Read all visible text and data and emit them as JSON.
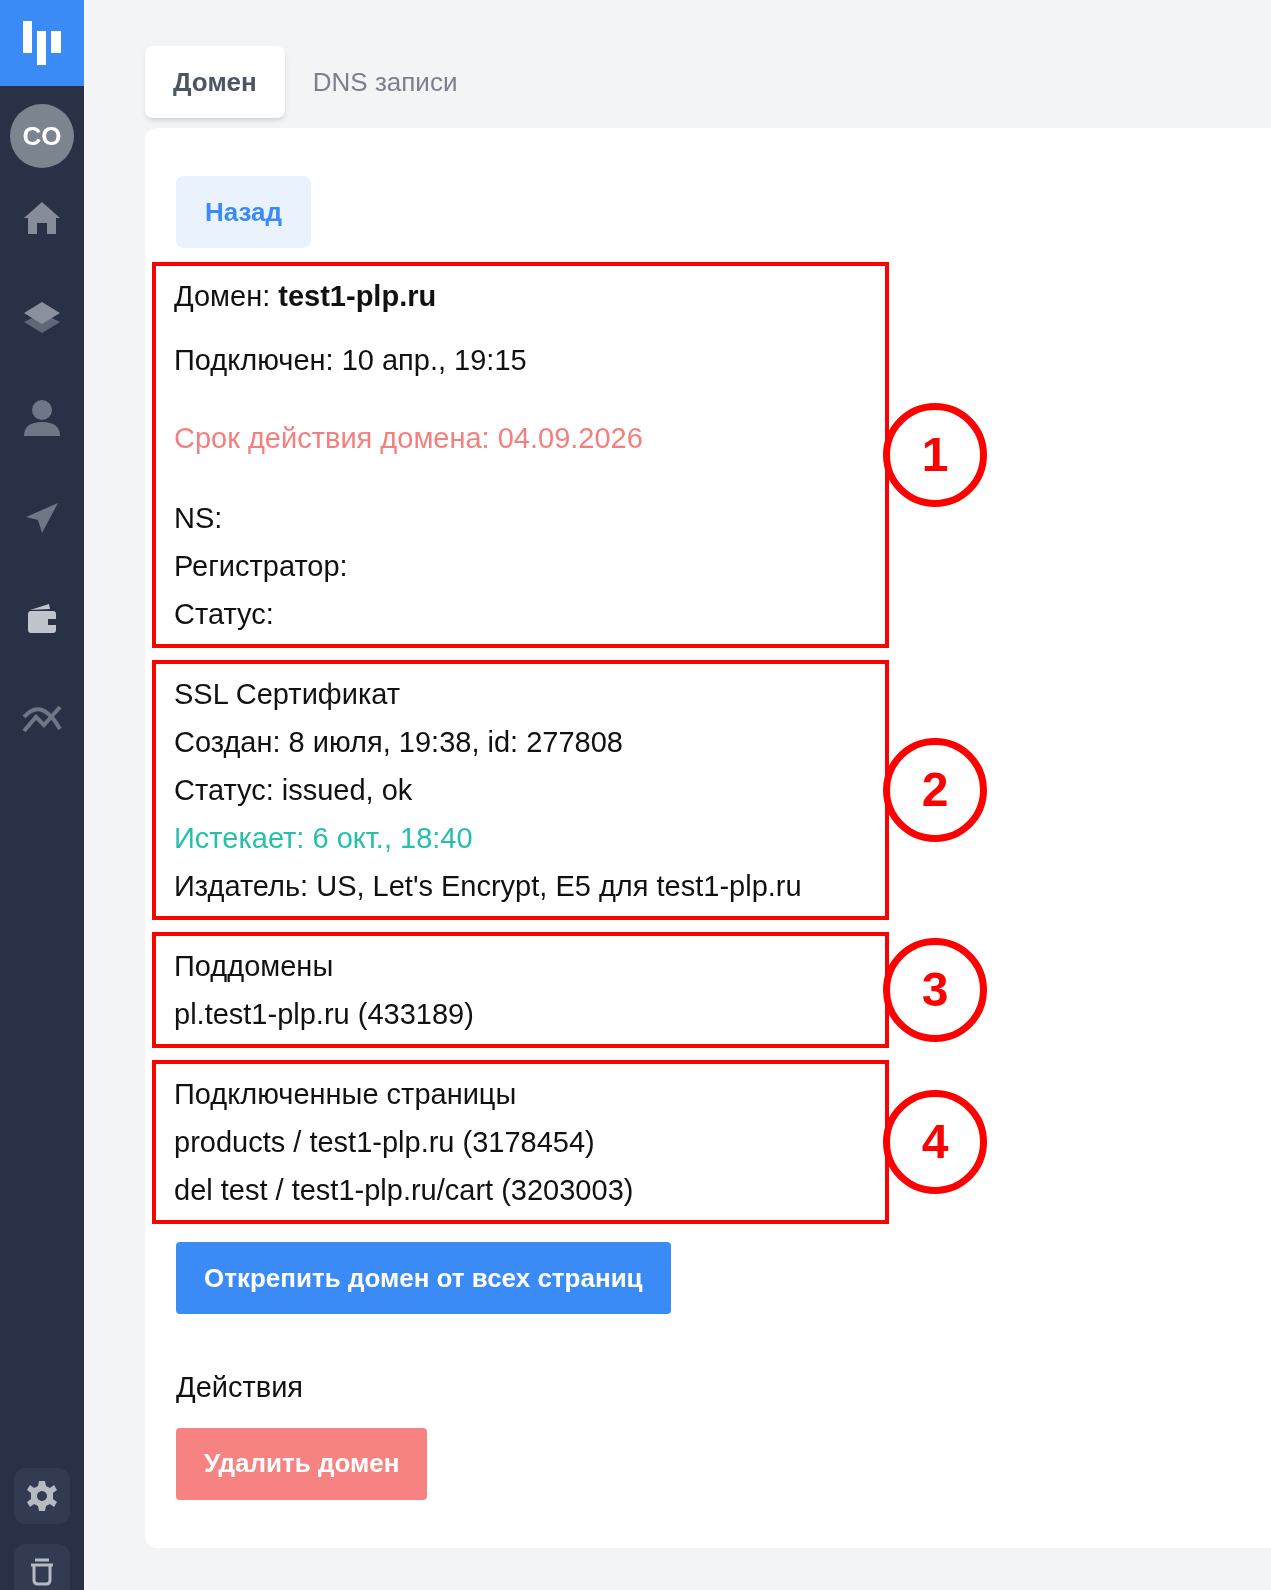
{
  "sidebar": {
    "avatar": "CO",
    "nav": [
      {
        "kind": "home"
      },
      {
        "kind": "layers"
      },
      {
        "kind": "user"
      },
      {
        "kind": "send"
      },
      {
        "kind": "wallet"
      },
      {
        "kind": "chart"
      }
    ],
    "bottom": [
      {
        "kind": "settings"
      },
      {
        "kind": "trash"
      }
    ]
  },
  "tabs": [
    {
      "label": "Домен",
      "selected": true
    },
    {
      "label": "DNS записи",
      "selected": false
    }
  ],
  "back_button": "Назад",
  "sections": [
    {
      "kind": "domain",
      "annotation": "1",
      "lines": [
        {
          "text": "Домен: **test1-plp.ru**",
          "kind": "plain"
        },
        {
          "text": "Подключен: 10 апр., 19:15",
          "kind": "plain"
        },
        {
          "text": "Срок действия домена: 04.09.2026",
          "kind": "danger"
        },
        {
          "text": "NS:",
          "kind": "plain"
        },
        {
          "text": "Регистратор:",
          "kind": "plain"
        },
        {
          "text": "Статус:",
          "kind": "plain"
        }
      ]
    },
    {
      "kind": "list",
      "annotation": "2",
      "lines": [
        {
          "text": "SSL Сертификат",
          "kind": "plain"
        },
        {
          "text": "Создан: 8 июля, 19:38, id: 277808",
          "kind": "plain"
        },
        {
          "text": "Статус: issued, ok",
          "kind": "plain"
        },
        {
          "text": "Истекает: 6 окт., 18:40",
          "kind": "success"
        },
        {
          "text": "Издатель: US, Let's Encrypt, E5 для test1-plp.ru",
          "kind": "plain"
        }
      ]
    },
    {
      "kind": "list",
      "annotation": "3",
      "lines": [
        {
          "text": "Поддомены",
          "kind": "plain"
        },
        {
          "text": "pl.test1-plp.ru (433189)",
          "kind": "plain"
        }
      ]
    },
    {
      "kind": "list",
      "annotation": "4",
      "lines": [
        {
          "text": "Подключенные страницы",
          "kind": "plain"
        },
        {
          "text": "products / test1-plp.ru (3178454)",
          "kind": "plain"
        },
        {
          "text": "del test / test1-plp.ru/cart (3203003)",
          "kind": "plain"
        }
      ]
    }
  ],
  "detach_button": "Открепить домен от всех страниц",
  "actions_heading": "Действия",
  "delete_button": "Удалить домен"
}
